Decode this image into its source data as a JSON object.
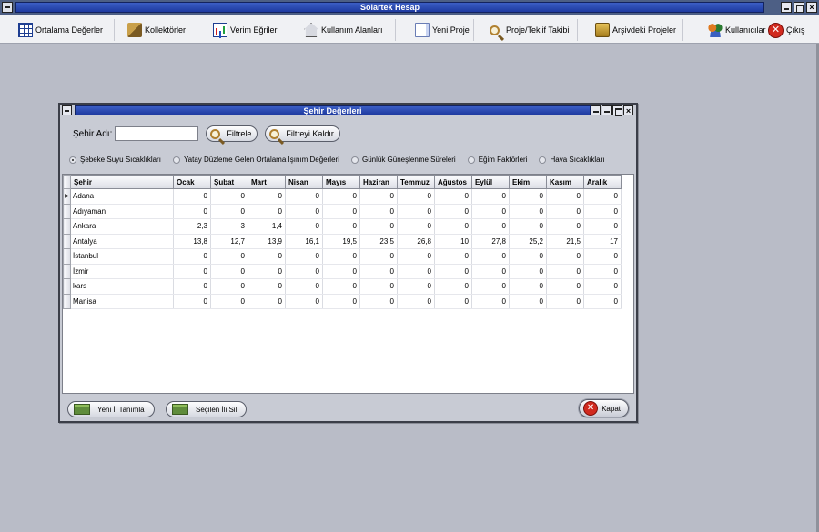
{
  "window": {
    "title": "Solartek Hesap"
  },
  "toolbar": {
    "ortalama": "Ortalama Değerler",
    "kollektorler": "Kollektörler",
    "verim": "Verim Eğrileri",
    "kullanim": "Kullanım Alanları",
    "yeni_proje": "Yeni Proje",
    "teklif": "Proje/Teklif Takibi",
    "arsiv": "Arşivdeki Projeler",
    "kullanicilar": "Kullanıcılar",
    "cikis": "Çıkış"
  },
  "dialog": {
    "title": "Şehir Değerleri",
    "filter_label": "Şehir Adı:",
    "filter_value": "",
    "filter_button": "Filtrele",
    "clear_button": "Filtreyi Kaldır",
    "radios": [
      "Şebeke Suyu Sıcaklıkları",
      "Yatay Düzleme Gelen Ortalama Işınım Değerleri",
      "Günlük Güneşlenme Süreleri",
      "Eğim Faktörleri",
      "Hava Sıcaklıkları"
    ],
    "selected_radio": "Şebeke Suyu Sıcaklıkları",
    "columns": [
      "Şehir",
      "Ocak",
      "Şubat",
      "Mart",
      "Nisan",
      "Mayıs",
      "Haziran",
      "Temmuz",
      "Ağustos",
      "Eylül",
      "Ekim",
      "Kasım",
      "Aralık"
    ],
    "rows": [
      {
        "city": "Adana",
        "values": [
          "0",
          "0",
          "0",
          "0",
          "0",
          "0",
          "0",
          "0",
          "0",
          "0",
          "0",
          "0"
        ]
      },
      {
        "city": "Adıyaman",
        "values": [
          "0",
          "0",
          "0",
          "0",
          "0",
          "0",
          "0",
          "0",
          "0",
          "0",
          "0",
          "0"
        ]
      },
      {
        "city": "Ankara",
        "values": [
          "2,3",
          "3",
          "1,4",
          "0",
          "0",
          "0",
          "0",
          "0",
          "0",
          "0",
          "0",
          "0"
        ]
      },
      {
        "city": "Antalya",
        "values": [
          "13,8",
          "12,7",
          "13,9",
          "16,1",
          "19,5",
          "23,5",
          "26,8",
          "10",
          "27,8",
          "25,2",
          "21,5",
          "17"
        ]
      },
      {
        "city": "İstanbul",
        "values": [
          "0",
          "0",
          "0",
          "0",
          "0",
          "0",
          "0",
          "0",
          "0",
          "0",
          "0",
          "0"
        ]
      },
      {
        "city": "İzmir",
        "values": [
          "0",
          "0",
          "0",
          "0",
          "0",
          "0",
          "0",
          "0",
          "0",
          "0",
          "0",
          "0"
        ]
      },
      {
        "city": "kars",
        "values": [
          "0",
          "0",
          "0",
          "0",
          "0",
          "0",
          "0",
          "0",
          "0",
          "0",
          "0",
          "0"
        ]
      },
      {
        "city": "Manisa",
        "values": [
          "0",
          "0",
          "0",
          "0",
          "0",
          "0",
          "0",
          "0",
          "0",
          "0",
          "0",
          "0"
        ]
      }
    ],
    "new_button": "Yeni İl Tanımla",
    "delete_button": "Seçilen İli Sil",
    "close_button": "Kapat"
  }
}
